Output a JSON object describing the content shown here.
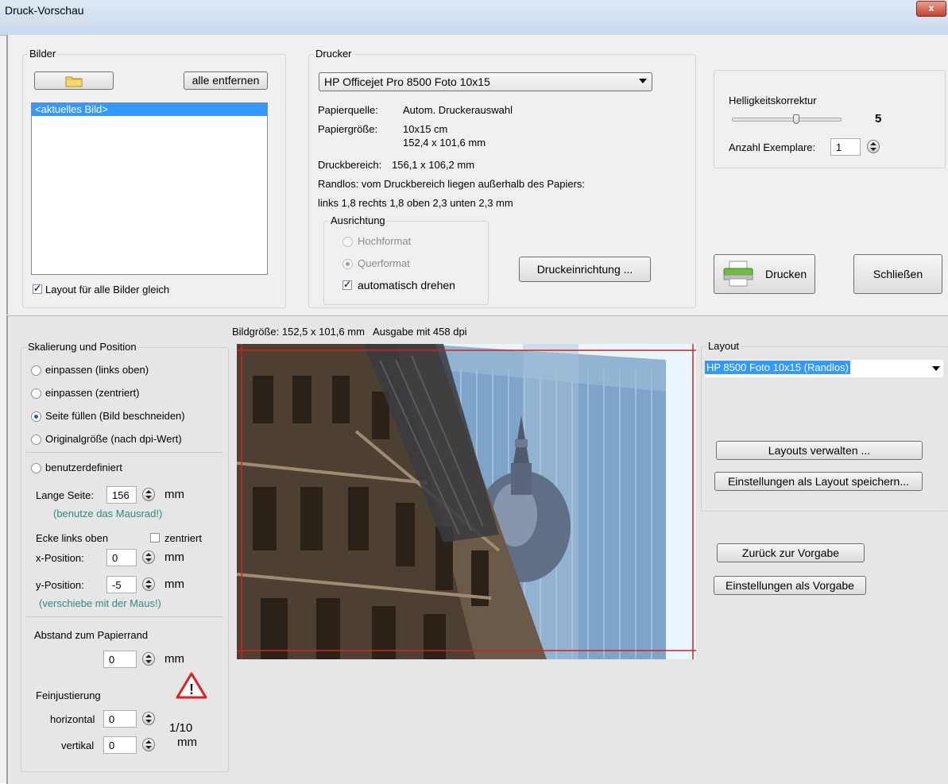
{
  "window": {
    "title": "Druck-Vorschau",
    "close_glyph": "x"
  },
  "bilder": {
    "legend": "Bilder",
    "remove_all_label": "alle entfernen",
    "items": [
      "<aktuelles Bild>"
    ],
    "layout_same_label": "Layout für alle Bilder gleich"
  },
  "drucker": {
    "legend": "Drucker",
    "printer_selected": "HP Officejet Pro 8500 Foto 10x15",
    "paper_source_label": "Papierquelle:",
    "paper_source_value": "Autom. Druckerauswahl",
    "paper_size_label": "Papiergröße:",
    "paper_size_value1": "10x15 cm",
    "paper_size_value2": "152,4 x 101,6 mm",
    "print_area_label": "Druckbereich:",
    "print_area_value": "156,1 x 106,2 mm",
    "borderless_text": "Randlos: vom Druckbereich liegen außerhalb des Papiers:",
    "margins_text": "links 1,8  rechts 1,8  oben 2,3  unten 2,3  mm",
    "orientation_legend": "Ausrichtung",
    "portrait_label": "Hochformat",
    "landscape_label": "Querformat",
    "auto_rotate_label": "automatisch drehen",
    "setup_button": "Druckeinrichtung ..."
  },
  "brightness": {
    "label": "Helligkeitskorrektur",
    "value": "5",
    "level": 0.6,
    "copies_label": "Anzahl Exemplare:",
    "copies_value": "1"
  },
  "actions": {
    "print_label": "Drucken",
    "close_label": "Schließen"
  },
  "preview": {
    "info_text": "Bildgröße: 152,5 x 101,6 mm   Ausgabe mit 458 dpi"
  },
  "scaling": {
    "legend": "Skalierung und Position",
    "fit_top_left": "einpassen (links oben)",
    "fit_centered": "einpassen (zentriert)",
    "fill_page": "Seite füllen (Bild beschneiden)",
    "original_size": "Originalgröße (nach dpi-Wert)",
    "custom": "benutzerdefiniert",
    "long_side_label": "Lange Seite:",
    "long_side_value": "156",
    "mm": "mm",
    "mousewheel_hint": "(benutze das Mausrad!)",
    "corner_label": "Ecke links oben",
    "centered_label": "zentriert",
    "x_label": "x-Position:",
    "x_value": "0",
    "y_label": "y-Position:",
    "y_value": "-5",
    "mouse_hint": "(verschiebe mit der Maus!)",
    "distance_label": "Abstand  zum Papierrand",
    "distance_value": "0",
    "fine_label": "Feinjustierung",
    "horizontal_label": "horizontal",
    "horizontal_value": "0",
    "vertical_label": "vertikal",
    "vertical_value": "0",
    "fine_unit1": "1/10",
    "fine_unit2": "mm",
    "warning_glyph": "!"
  },
  "layout": {
    "legend": "Layout",
    "selected": "HP 8500 Foto 10x15 (Randlos)",
    "manage_button": "Layouts verwalten ...",
    "save_button": "Einstellungen als Layout speichern...",
    "back_default_button": "Zurück zur Vorgabe",
    "as_default_button": "Einstellungen als Vorgabe"
  },
  "colors": {
    "selection": "#3399ff",
    "hint": "#2f8a82",
    "crop_line": "#d42020",
    "warning": "#e02020"
  }
}
